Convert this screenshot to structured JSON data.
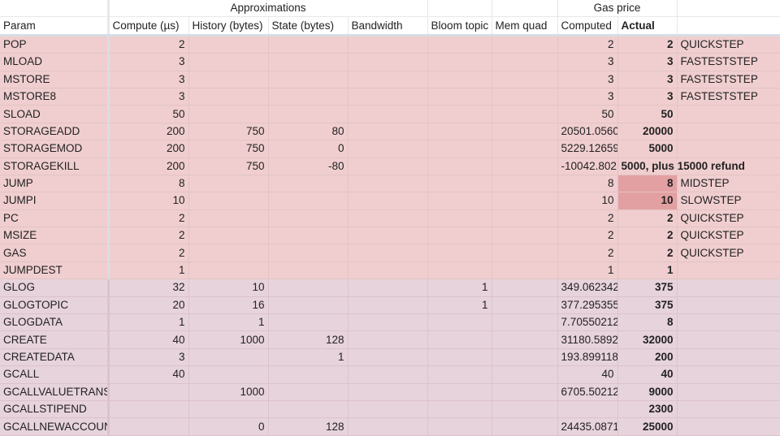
{
  "header": {
    "group_approximations": "Approximations",
    "group_gas_price": "Gas price",
    "columns": [
      "Param",
      "Compute (µs)",
      "History (bytes)",
      "State (bytes)",
      "Bandwidth",
      "Bloom topic",
      "Mem quad",
      "Computed",
      "Actual",
      ""
    ]
  },
  "rows": [
    {
      "param": "POP",
      "compute": "2",
      "history": "",
      "state": "",
      "bandwidth": "",
      "bloom": "",
      "memquad": "",
      "computed": "2",
      "actual": "2",
      "note": "QUICKSTEP",
      "group": "pink"
    },
    {
      "param": "MLOAD",
      "compute": "3",
      "history": "",
      "state": "",
      "bandwidth": "",
      "bloom": "",
      "memquad": "",
      "computed": "3",
      "actual": "3",
      "note": "FASTESTSTEP",
      "group": "pink"
    },
    {
      "param": "MSTORE",
      "compute": "3",
      "history": "",
      "state": "",
      "bandwidth": "",
      "bloom": "",
      "memquad": "",
      "computed": "3",
      "actual": "3",
      "note": "FASTESTSTEP",
      "group": "pink"
    },
    {
      "param": "MSTORE8",
      "compute": "3",
      "history": "",
      "state": "",
      "bandwidth": "",
      "bloom": "",
      "memquad": "",
      "computed": "3",
      "actual": "3",
      "note": "FASTESTSTEP",
      "group": "pink"
    },
    {
      "param": "SLOAD",
      "compute": "50",
      "history": "",
      "state": "",
      "bandwidth": "",
      "bloom": "",
      "memquad": "",
      "computed": "50",
      "actual": "50",
      "note": "",
      "group": "pink"
    },
    {
      "param": "STORAGEADD",
      "compute": "200",
      "history": "750",
      "state": "80",
      "bandwidth": "",
      "bloom": "",
      "memquad": "",
      "computed": "20501.0560",
      "actual": "20000",
      "note": "",
      "group": "pink"
    },
    {
      "param": "STORAGEMOD",
      "compute": "200",
      "history": "750",
      "state": "0",
      "bandwidth": "",
      "bloom": "",
      "memquad": "",
      "computed": "5229.12659",
      "actual": "5000",
      "note": "",
      "group": "pink"
    },
    {
      "param": "STORAGEKILL",
      "compute": "200",
      "history": "750",
      "state": "-80",
      "bandwidth": "",
      "bloom": "",
      "memquad": "",
      "computed": "-10042.802",
      "actual": "5000, plus 15000 refund",
      "note": "",
      "group": "pink",
      "actual_overflow": true
    },
    {
      "param": "JUMP",
      "compute": "8",
      "history": "",
      "state": "",
      "bandwidth": "",
      "bloom": "",
      "memquad": "",
      "computed": "8",
      "actual": "8",
      "note": "MIDSTEP",
      "group": "pink",
      "highlight": true
    },
    {
      "param": "JUMPI",
      "compute": "10",
      "history": "",
      "state": "",
      "bandwidth": "",
      "bloom": "",
      "memquad": "",
      "computed": "10",
      "actual": "10",
      "note": "SLOWSTEP",
      "group": "pink",
      "highlight": true
    },
    {
      "param": "PC",
      "compute": "2",
      "history": "",
      "state": "",
      "bandwidth": "",
      "bloom": "",
      "memquad": "",
      "computed": "2",
      "actual": "2",
      "note": "QUICKSTEP",
      "group": "pink"
    },
    {
      "param": "MSIZE",
      "compute": "2",
      "history": "",
      "state": "",
      "bandwidth": "",
      "bloom": "",
      "memquad": "",
      "computed": "2",
      "actual": "2",
      "note": "QUICKSTEP",
      "group": "pink"
    },
    {
      "param": "GAS",
      "compute": "2",
      "history": "",
      "state": "",
      "bandwidth": "",
      "bloom": "",
      "memquad": "",
      "computed": "2",
      "actual": "2",
      "note": "QUICKSTEP",
      "group": "pink"
    },
    {
      "param": "JUMPDEST",
      "compute": "1",
      "history": "",
      "state": "",
      "bandwidth": "",
      "bloom": "",
      "memquad": "",
      "computed": "1",
      "actual": "1",
      "note": "",
      "group": "pink"
    },
    {
      "param": "GLOG",
      "compute": "32",
      "history": "10",
      "state": "",
      "bandwidth": "",
      "bloom": "1",
      "memquad": "",
      "computed": "349.062342",
      "actual": "375",
      "note": "",
      "group": "mauve"
    },
    {
      "param": "GLOGTOPIC",
      "compute": "20",
      "history": "16",
      "state": "",
      "bandwidth": "",
      "bloom": "1",
      "memquad": "",
      "computed": "377.295355",
      "actual": "375",
      "note": "",
      "group": "mauve"
    },
    {
      "param": "GLOGDATA",
      "compute": "1",
      "history": "1",
      "state": "",
      "bandwidth": "",
      "bloom": "",
      "memquad": "",
      "computed": "7.70550212",
      "actual": "8",
      "note": "",
      "group": "mauve"
    },
    {
      "param": "CREATE",
      "compute": "40",
      "history": "1000",
      "state": "128",
      "bandwidth": "",
      "bloom": "",
      "memquad": "",
      "computed": "31180.5892",
      "actual": "32000",
      "note": "",
      "group": "mauve"
    },
    {
      "param": "CREATEDATA",
      "compute": "3",
      "history": "",
      "state": "1",
      "bandwidth": "",
      "bloom": "",
      "memquad": "",
      "computed": "193.899118",
      "actual": "200",
      "note": "",
      "group": "mauve"
    },
    {
      "param": "GCALL",
      "compute": "40",
      "history": "",
      "state": "",
      "bandwidth": "",
      "bloom": "",
      "memquad": "",
      "computed": "40",
      "actual": "40",
      "note": "",
      "group": "mauve"
    },
    {
      "param": "GCALLVALUETRANSFER",
      "compute": "",
      "history": "1000",
      "state": "",
      "bandwidth": "",
      "bloom": "",
      "memquad": "",
      "computed": "6705.50212",
      "actual": "9000",
      "note": "",
      "group": "mauve"
    },
    {
      "param": "GCALLSTIPEND",
      "compute": "",
      "history": "",
      "state": "",
      "bandwidth": "",
      "bloom": "",
      "memquad": "",
      "computed": "",
      "actual": "2300",
      "note": "",
      "group": "mauve"
    },
    {
      "param": "GCALLNEWACCOUNT",
      "compute": "",
      "history": "0",
      "state": "128",
      "bandwidth": "",
      "bloom": "",
      "memquad": "",
      "computed": "24435.0871",
      "actual": "25000",
      "note": "",
      "group": "mauve"
    }
  ]
}
